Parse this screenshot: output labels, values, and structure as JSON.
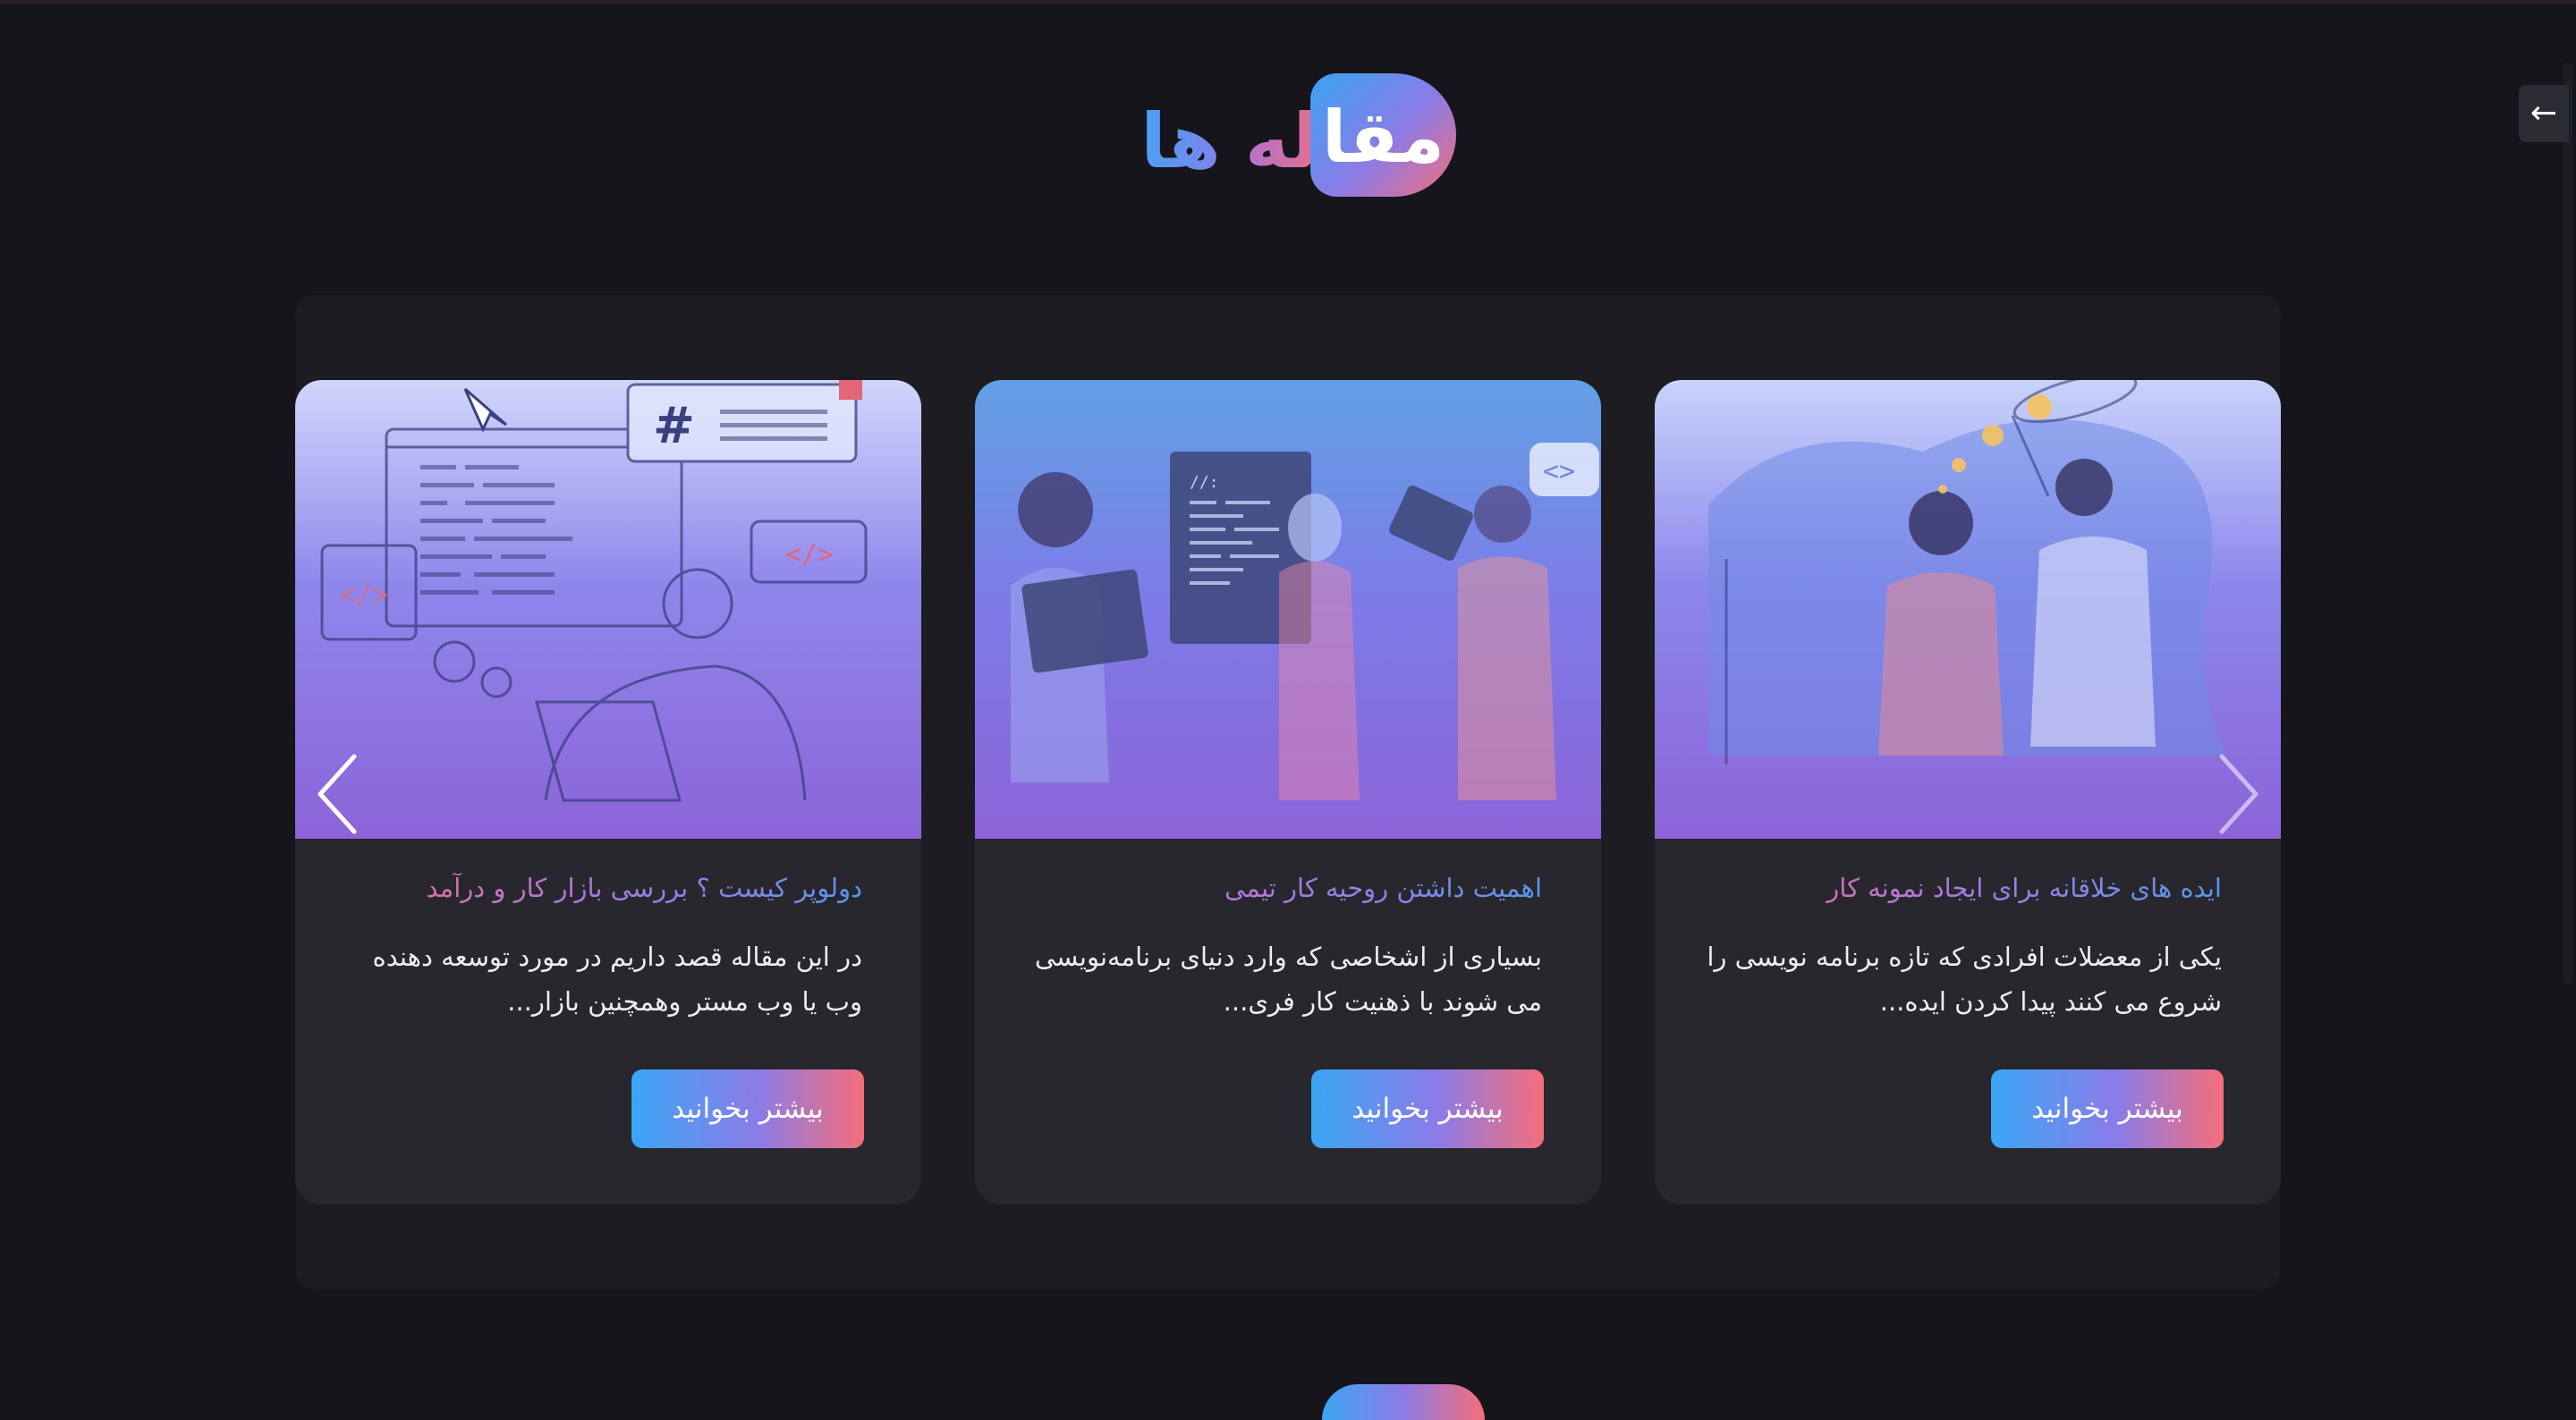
{
  "section": {
    "title_part_1": "مقا",
    "title_part_2": "له",
    "title_part_3": "ها"
  },
  "articles": [
    {
      "title": "دولوپر کیست ؟ بررسی بازار کار و درآمد",
      "excerpt": "در این مقاله قصد داریم در مورد توسعه دهنده وب یا وب مستر وهمچنین بازار...",
      "button": "بیشتر بخوانید"
    },
    {
      "title": "اهمیت داشتن روحیه کار تیمی",
      "excerpt": "بسیاری از اشخاصی که وارد دنیای برنامه‌نویسی می شوند با ذهنیت کار فری...",
      "button": "بیشتر بخوانید"
    },
    {
      "title": "ایده های خلاقانه برای ایجاد نمونه کار",
      "excerpt": "یکی از معضلات افرادی که تازه برنامه نویسی را شروع می کنند پیدا کردن ایده...",
      "button": "بیشتر بخوانید"
    }
  ],
  "colors": {
    "background": "#15151b",
    "panel": "#1c1c21",
    "card": "#27272d",
    "accent_blue": "#3aa6f5",
    "accent_purple": "#8d7be6",
    "accent_pink": "#f56e7a"
  },
  "icons": {
    "prev": "chevron-left-icon",
    "next": "chevron-right-icon",
    "side": "arrow-left-icon"
  }
}
